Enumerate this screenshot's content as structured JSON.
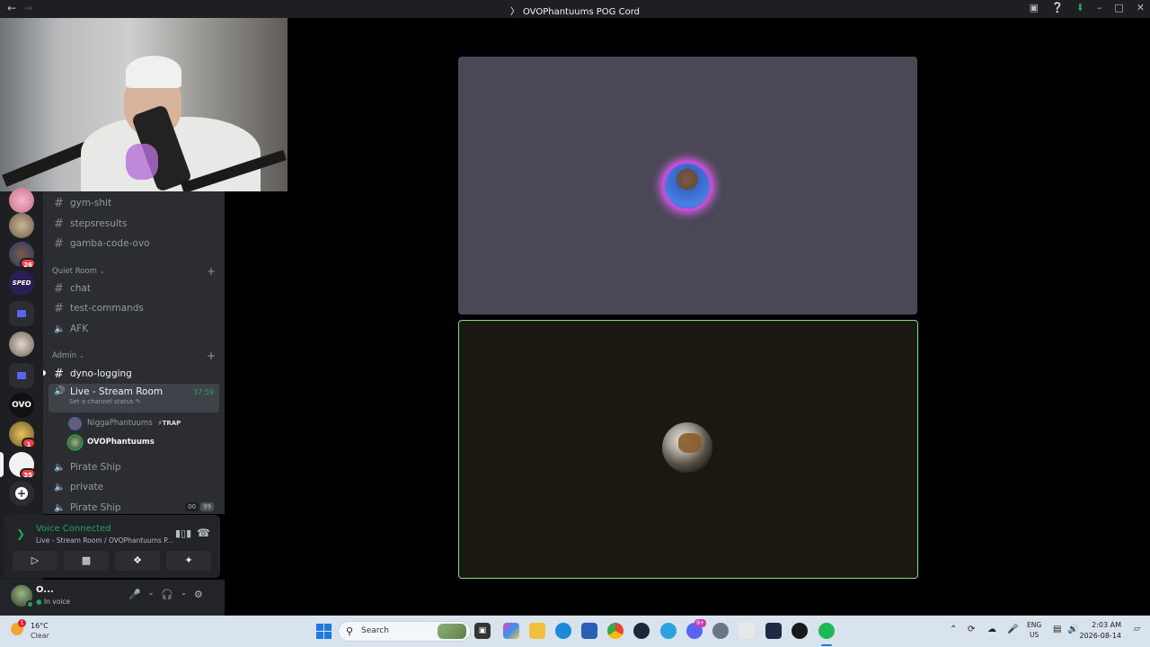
{
  "window": {
    "title": "OVOPhantuums POG Cord",
    "back": "←",
    "forward": "→"
  },
  "colors": {
    "accent_green": "#23a55a",
    "speaking_ring": "#c94bd8",
    "tile_border": "#7ae07a",
    "notification_red": "#f23f43"
  },
  "servers": {
    "badges": [
      "26",
      "1",
      "35"
    ],
    "labels": [
      "OVO"
    ]
  },
  "channels": {
    "top_text": [
      {
        "name": "gym-shit"
      },
      {
        "name": "stepsresults"
      },
      {
        "name": "gamba-code-ovo"
      }
    ],
    "quiet_room": {
      "label": "Quiet Room",
      "items": [
        {
          "name": "chat",
          "kind": "text"
        },
        {
          "name": "test-commands",
          "kind": "text"
        },
        {
          "name": "AFK",
          "kind": "voice"
        }
      ]
    },
    "admin": {
      "label": "Admin",
      "dyno": "dyno-logging",
      "live": {
        "name": "Live - Stream Room",
        "timer": "37:59",
        "status": "Set a channel status"
      },
      "members": [
        {
          "name": "NiggaPhantuums",
          "tag": "TRAP"
        },
        {
          "name": "OVOPhantuums"
        }
      ],
      "after": [
        {
          "name": "Pirate Ship"
        },
        {
          "name": "private"
        },
        {
          "name": "Pirate Ship",
          "counts": [
            "00",
            "99"
          ]
        }
      ]
    }
  },
  "voice_panel": {
    "status": "Voice Connected",
    "location": "Live - Stream Room / OVOPhantuums P..."
  },
  "user": {
    "name": "O...",
    "status": "In voice"
  },
  "taskbar": {
    "weather_temp": "16°C",
    "weather_desc": "Clear",
    "weather_alert": "1",
    "search_placeholder": "Search",
    "lang_top": "ENG",
    "lang_bottom": "US",
    "time": "2:03 AM",
    "date": "2026-08-14",
    "discord_badge": "9+"
  }
}
